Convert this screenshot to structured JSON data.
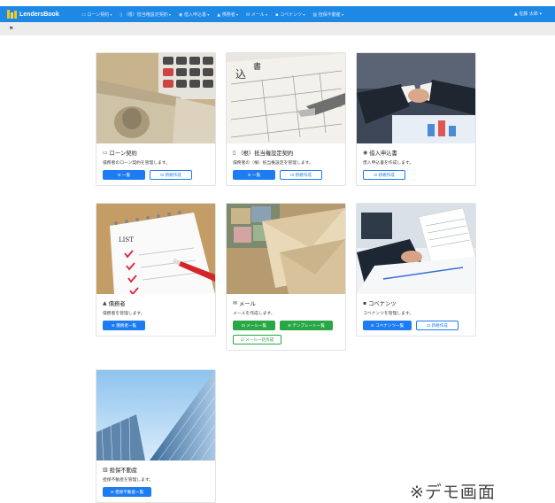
{
  "brand": {
    "name": "LendersBook"
  },
  "nav": {
    "items": [
      {
        "icon": "card-icon",
        "label": "ローン契約"
      },
      {
        "icon": "doc-icon",
        "label": "（根）抵当権設定契約"
      },
      {
        "icon": "eye-icon",
        "label": "借入申込書"
      },
      {
        "icon": "user-icon",
        "label": "債務者"
      },
      {
        "icon": "mail-icon",
        "label": "メール"
      },
      {
        "icon": "briefcase-icon",
        "label": "コベナンツ"
      },
      {
        "icon": "building-icon",
        "label": "担保不動産"
      }
    ],
    "user": "▲ 佐藤 太郎 ▾"
  },
  "cards": [
    {
      "icon": "card-icon",
      "title": "ローン契約",
      "desc": "債務者のローン契約を管理します。",
      "buttons": [
        {
          "label": "≡ 一覧",
          "style": "primary"
        },
        {
          "label": "⊡ 新規作成",
          "style": "outline-primary"
        }
      ]
    },
    {
      "icon": "doc-icon",
      "title": "（根）抵当権設定契約",
      "desc": "債務者の（根）抵当権設定を管理します。",
      "buttons": [
        {
          "label": "≡ 一覧",
          "style": "primary"
        },
        {
          "label": "⊡ 新規作成",
          "style": "outline-primary"
        }
      ]
    },
    {
      "icon": "eye-icon",
      "title": "借入申込書",
      "desc": "借入申込書を作成します。",
      "buttons": [
        {
          "label": "⊡ 新規作成",
          "style": "outline-primary"
        }
      ]
    },
    {
      "icon": "user-icon",
      "title": "債務者",
      "desc": "債務者を管理します。",
      "buttons": [
        {
          "label": "≡ 債務者一覧",
          "style": "primary"
        }
      ]
    },
    {
      "icon": "mail-icon",
      "title": "メール",
      "desc": "メールを作成します。",
      "buttons": [
        {
          "label": "⊡ メール一覧",
          "style": "success"
        },
        {
          "label": "≡ テンプレート一覧",
          "style": "success"
        },
        {
          "label": "☑ メール一括作成",
          "style": "outline-success"
        }
      ]
    },
    {
      "icon": "briefcase-icon",
      "title": "コベナンツ",
      "desc": "コベナンツを管理します。",
      "buttons": [
        {
          "label": "≡ コベナンツ一覧",
          "style": "primary"
        },
        {
          "label": "⊡ 新規作成",
          "style": "outline-primary"
        }
      ]
    },
    {
      "icon": "building-icon",
      "title": "担保不動産",
      "desc": "担保不動産を管理します。",
      "buttons": [
        {
          "label": "≡ 担保不動産一覧",
          "style": "primary"
        }
      ]
    }
  ],
  "watermark": "※デモ画面"
}
